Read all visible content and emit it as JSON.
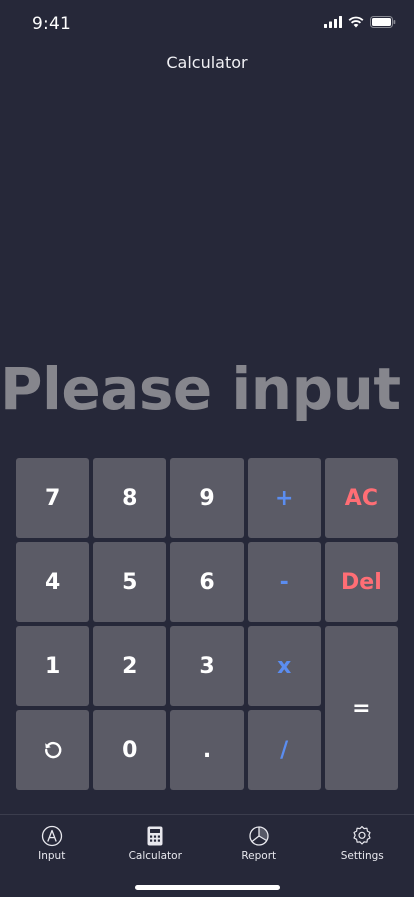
{
  "status_bar": {
    "time": "9:41"
  },
  "header": {
    "title": "Calculator"
  },
  "display": {
    "text": "Please input"
  },
  "keypad": {
    "seven": "7",
    "eight": "8",
    "nine": "9",
    "plus": "+",
    "all_clear": "AC",
    "four": "4",
    "five": "5",
    "six": "6",
    "minus": "-",
    "delete": "Del",
    "one": "1",
    "two": "2",
    "three": "3",
    "multiply": "x",
    "equals": "=",
    "zero": "0",
    "decimal": ".",
    "divide": "/",
    "undo_icon": "undo-icon"
  },
  "tabs": [
    {
      "label": "Input",
      "icon": "pen-circle-icon"
    },
    {
      "label": "Calculator",
      "icon": "calculator-icon"
    },
    {
      "label": "Report",
      "icon": "pie-chart-icon"
    },
    {
      "label": "Settings",
      "icon": "gear-icon"
    }
  ],
  "colors": {
    "background": "#262839",
    "key": "#5b5b66",
    "operator": "#5b8df0",
    "danger": "#ff6e75",
    "display_text": "#86868d"
  }
}
